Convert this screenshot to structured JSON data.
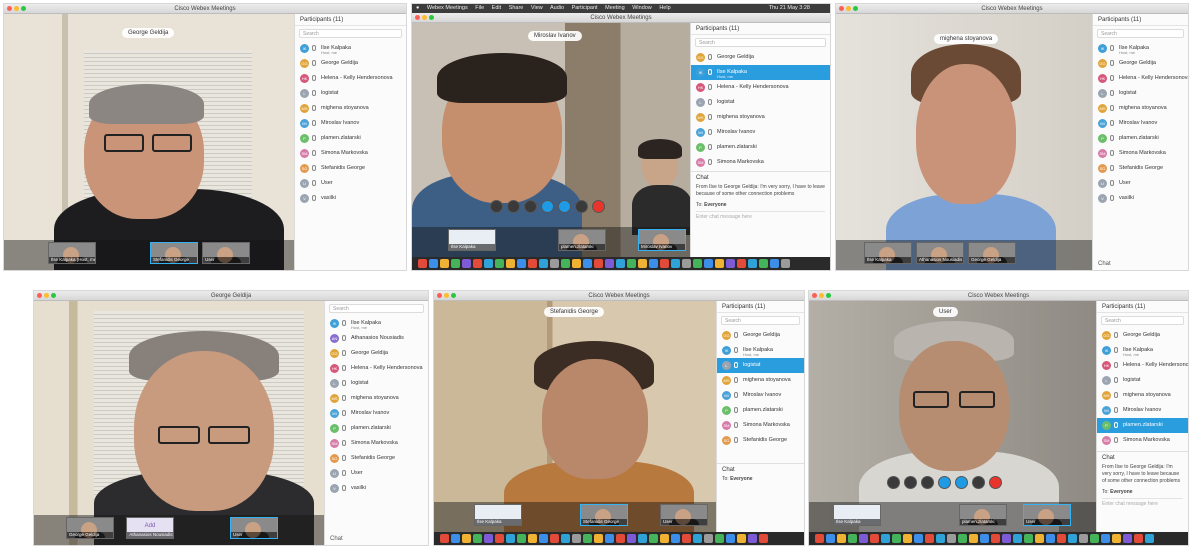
{
  "app": {
    "window_title": "Cisco Webex Meetings",
    "participants_title": "Participants (11)",
    "search_placeholder": "Search",
    "chat_label": "Chat",
    "add_label": "Add"
  },
  "mac_menubar": {
    "items": [
      "Webex Meetings",
      "File",
      "Edit",
      "Share",
      "View",
      "Audio",
      "Participant",
      "Meeting",
      "Window",
      "Help"
    ],
    "clock": "Thu 21 May 3:28"
  },
  "participants": [
    {
      "name": "Ilse Kalpaka",
      "sub": "Host, me",
      "initials": "IK",
      "color": "#3f9fd7"
    },
    {
      "name": "Athanasios Nousiadis",
      "sub": "",
      "initials": "AN",
      "color": "#8a6fd1"
    },
    {
      "name": "George Geldija",
      "sub": "",
      "initials": "GG",
      "color": "#e0a43b"
    },
    {
      "name": "Helena - Kelly Hendersonova",
      "sub": "",
      "initials": "HK",
      "color": "#d6577a"
    },
    {
      "name": "logistat",
      "sub": "",
      "initials": "L",
      "color": "#9aa5b1"
    },
    {
      "name": "mighena stoyanova",
      "sub": "",
      "initials": "MS",
      "color": "#e0a43b"
    },
    {
      "name": "Miroslav Ivanov",
      "sub": "",
      "initials": "MI",
      "color": "#4aa3d8"
    },
    {
      "name": "plamen.zlatarski",
      "sub": "",
      "initials": "P",
      "color": "#6cbf6a"
    },
    {
      "name": "Simona Markovska",
      "sub": "",
      "initials": "SM",
      "color": "#d77ca8"
    },
    {
      "name": "Stefanidis George",
      "sub": "",
      "initials": "SG",
      "color": "#e39a4e"
    },
    {
      "name": "User",
      "sub": "",
      "initials": "U",
      "color": "#9aa5b1"
    },
    {
      "name": "vasilki",
      "sub": "",
      "initials": "V",
      "color": "#9aa5b1"
    }
  ],
  "panels": [
    {
      "speaker_label": "George Geldija",
      "thumbs": [
        "Ilse Kalpaka (Host, me)",
        "Stefanidis George",
        "User"
      ],
      "selected": -1
    },
    {
      "speaker_label": "Miroslav Ivanov",
      "thumbs": [
        "Ilse Kalpaka",
        "plamen.zlatarski",
        "Miroslav Ivanov"
      ],
      "selected": 1
    },
    {
      "speaker_label": "mighena stoyanova",
      "thumbs": [
        "Ilse Kalpaka",
        "Athanasios Nousiadis",
        "George Geldija"
      ],
      "selected": -1
    },
    {
      "speaker_label": "George Geldija",
      "thumbs": [
        "George Geldija",
        "Athanasios Nousiadis",
        "User"
      ],
      "selected": -1
    },
    {
      "speaker_label": "Stefanidis George",
      "thumbs": [
        "Ilse Kalpaka",
        "Stefanidis George",
        "User"
      ],
      "selected": 5
    },
    {
      "speaker_label": "User",
      "thumbs": [
        "Ilse Kalpaka",
        "plamen.zlatarski",
        "User"
      ],
      "selected": 7
    }
  ],
  "chat": {
    "title": "Chat",
    "message": "From Ilse to George Geldija: I'm very sorry, I have to leave because of some other connection problems",
    "to_label": "To:",
    "to_value": "Everyone",
    "input_placeholder": "Enter chat message here"
  },
  "colors": {
    "selected_row": "#2a9dde",
    "end_call": "#e8352b",
    "accent_blue": "#1f9be6"
  }
}
